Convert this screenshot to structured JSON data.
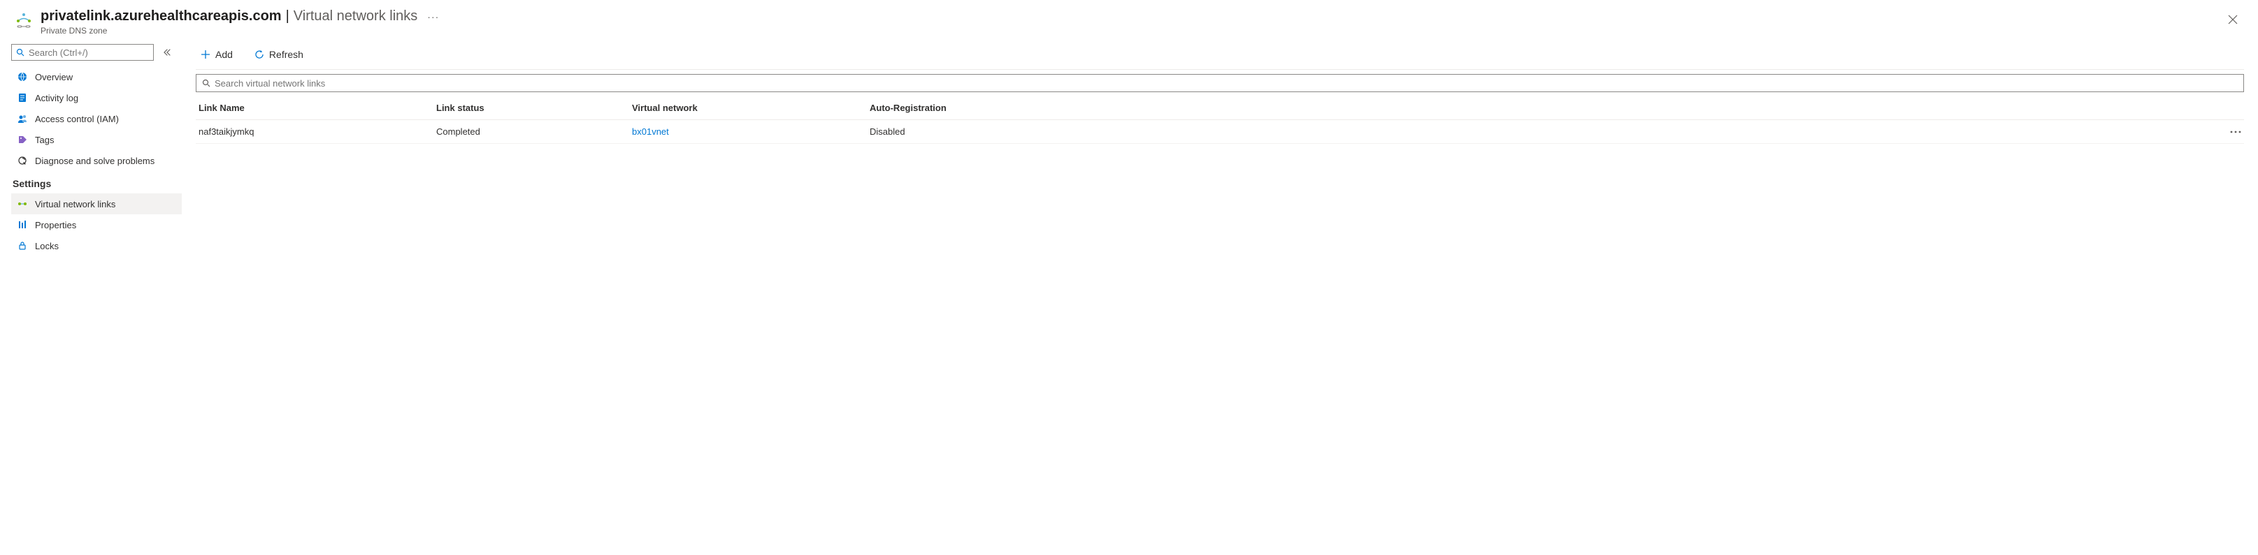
{
  "header": {
    "resource_name": "privatelink.azurehealthcareapis.com",
    "blade_name": "Virtual network links",
    "subtitle": "Private DNS zone",
    "more_label": "···"
  },
  "sidebar": {
    "search_placeholder": "Search (Ctrl+/)",
    "items_top": [
      {
        "id": "overview",
        "label": "Overview"
      },
      {
        "id": "activity-log",
        "label": "Activity log"
      },
      {
        "id": "iam",
        "label": "Access control (IAM)"
      },
      {
        "id": "tags",
        "label": "Tags"
      },
      {
        "id": "diagnose",
        "label": "Diagnose and solve problems"
      }
    ],
    "settings_header": "Settings",
    "items_settings": [
      {
        "id": "vnet-links",
        "label": "Virtual network links",
        "selected": true
      },
      {
        "id": "properties",
        "label": "Properties"
      },
      {
        "id": "locks",
        "label": "Locks"
      }
    ]
  },
  "toolbar": {
    "add_label": "Add",
    "refresh_label": "Refresh"
  },
  "main": {
    "search_placeholder": "Search virtual network links",
    "columns": {
      "link_name": "Link Name",
      "link_status": "Link status",
      "vnet": "Virtual network",
      "auto_reg": "Auto-Registration"
    },
    "rows": [
      {
        "link_name": "naf3taikjymkq",
        "link_status": "Completed",
        "vnet": "bx01vnet",
        "auto_reg": "Disabled"
      }
    ]
  }
}
